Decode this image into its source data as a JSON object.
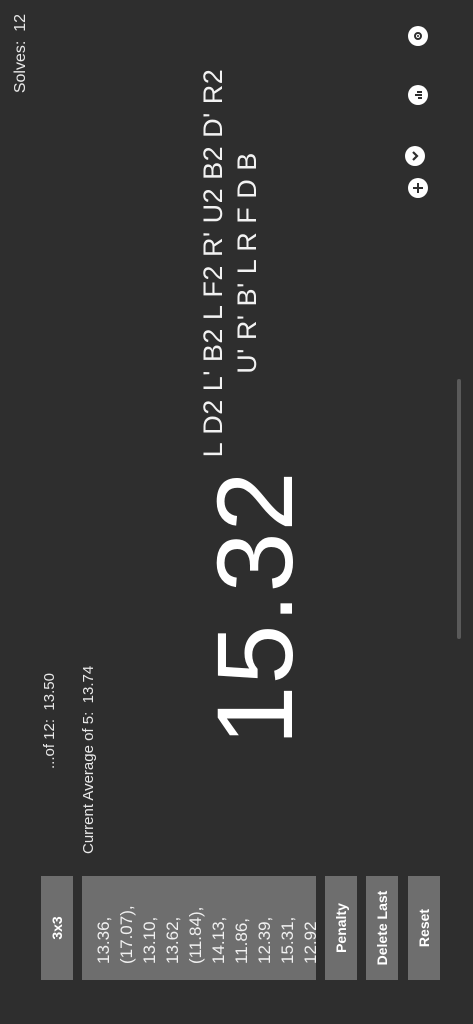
{
  "header": {
    "solves_label": "Solves:",
    "solves_count": "12",
    "icons": [
      "settings-icon",
      "stats-icon",
      "dropdown-icon",
      "add-icon"
    ]
  },
  "scramble": {
    "line1": "L D2 L' B2 L F2 R' U2 B2 D' R2",
    "line2": "U' R' B' L R F D B"
  },
  "timer": {
    "value": "15.32"
  },
  "averages": {
    "ao5_label": "Current Average of 5:",
    "ao5_value": "13.74",
    "ao12_label": "...of 12:",
    "ao12_value": "13.50"
  },
  "sidebar": {
    "puzzle_label": "3x3",
    "times": [
      "13.36,",
      "(17.07),",
      "13.10,",
      "13.62,",
      "(11.84),",
      "14.13,",
      "11.86,",
      "12.39,",
      "15.31,",
      "12.92"
    ],
    "penalty_label": "Penalty",
    "delete_label": "Delete Last",
    "reset_label": "Reset"
  },
  "colors": {
    "background": "#2e2e2e",
    "button": "#6e6e6e",
    "text": "#ffffff"
  }
}
